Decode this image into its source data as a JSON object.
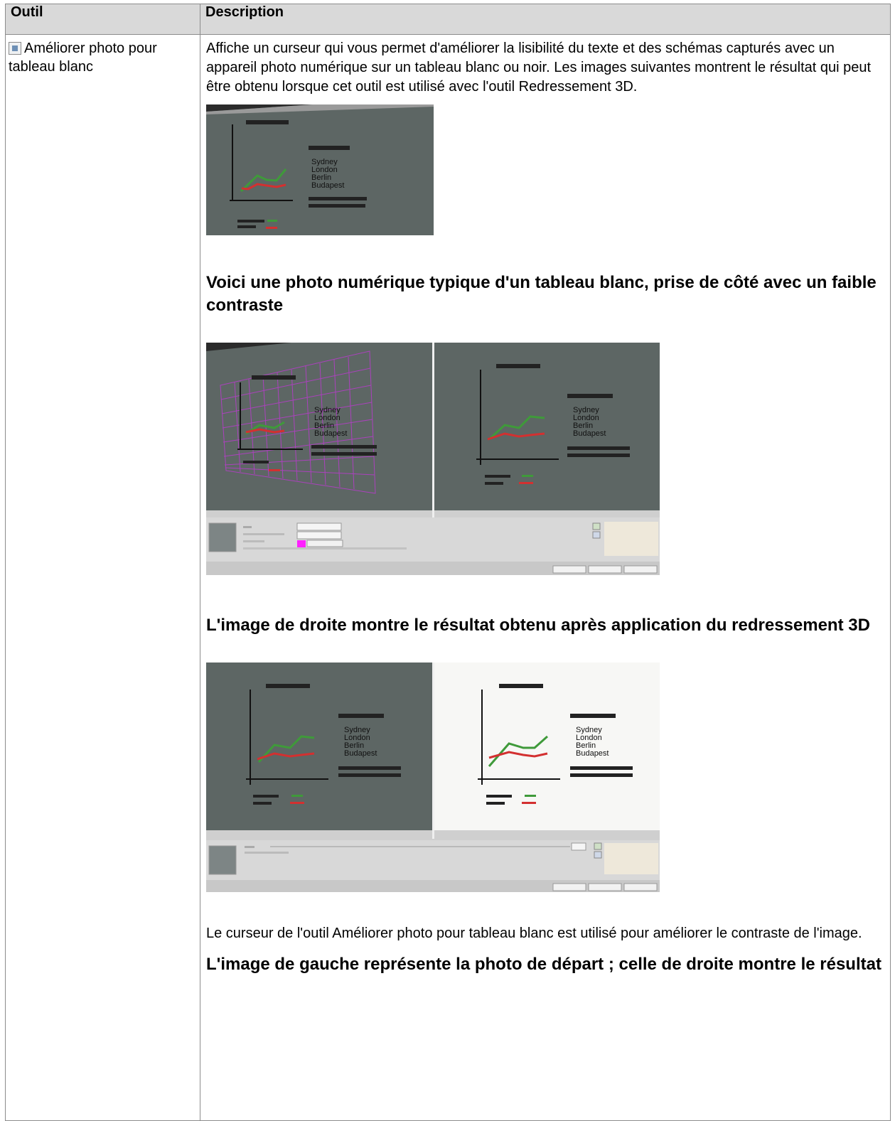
{
  "table": {
    "header_tool": "Outil",
    "header_description": "Description"
  },
  "tool": {
    "icon": "whiteboard-enhance-icon",
    "name": "Améliorer photo pour tableau blanc"
  },
  "description": {
    "intro": "Affiche un curseur qui vous permet d'améliorer la lisibilité du texte et des schémas capturés avec un appareil photo numérique sur un tableau blanc ou noir. Les images suivantes montrent le résultat qui peut être obtenu lorsque cet outil est utilisé avec l'outil Redressement 3D.",
    "caption1": "Voici une photo numérique typique d'un tableau blanc, prise de côté avec un faible contraste",
    "caption2": "L'image de droite montre le résultat obtenu après application du redressement 3D",
    "para2": "Le curseur de l'outil Améliorer photo pour tableau blanc est utilisé pour améliorer le contraste de l'image.",
    "caption3": "L'image de gauche représente la photo de départ ; celle de droite montre le résultat"
  },
  "whiteboard": {
    "legend": [
      "Sydney",
      "London",
      "Berlin",
      "Budapest"
    ],
    "colors": {
      "board": "#5d6664",
      "board_light": "#f7f7f5",
      "green": "#3f9a3a",
      "red": "#d33030",
      "grid": "#b43ec7"
    }
  }
}
